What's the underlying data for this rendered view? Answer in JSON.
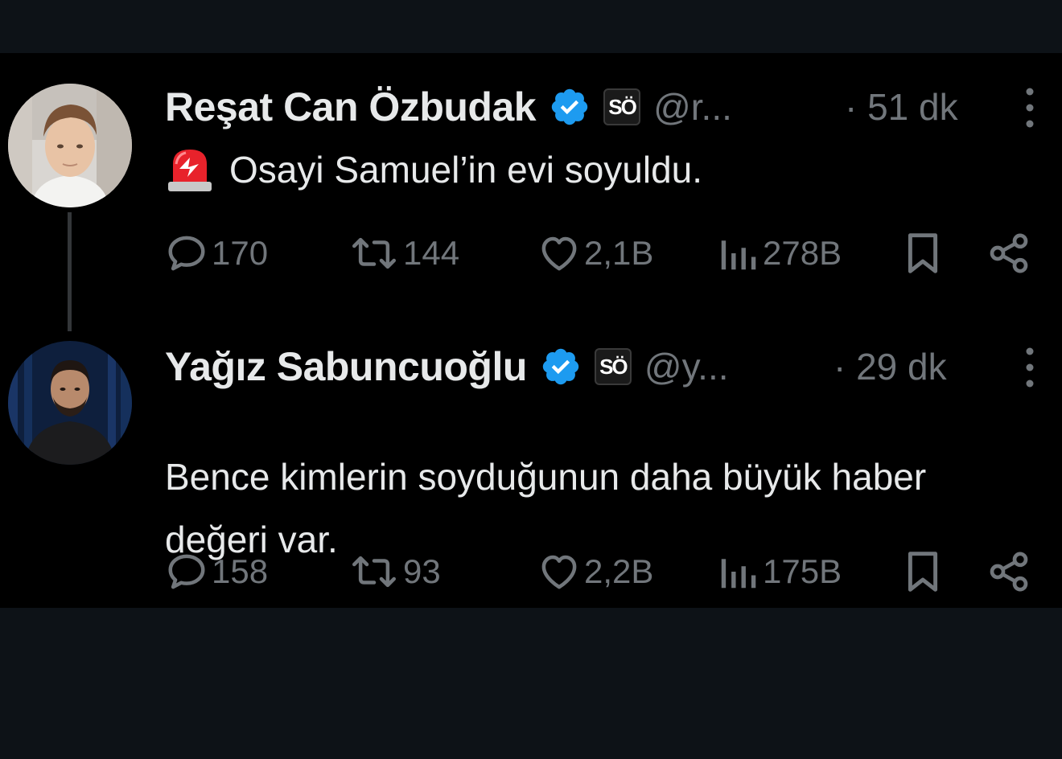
{
  "tweets": [
    {
      "display_name": "Reşat Can Özbudak",
      "verified_icon": "verified-badge-icon",
      "affiliate_badge": "SÖ",
      "handle": "@r...",
      "time": "· 51 dk",
      "emoji_icon": "police-light-icon",
      "text": "Osayi Samuel’in evi soyuldu.",
      "stats": {
        "replies": "170",
        "retweets": "144",
        "likes": "2,1B",
        "views": "278B"
      }
    },
    {
      "display_name": "Yağız Sabuncuoğlu",
      "verified_icon": "verified-badge-icon",
      "affiliate_badge": "SÖ",
      "handle": "@y...",
      "time": "· 29 dk",
      "text": "Bence kimlerin soyduğunun daha büyük haber değeri var.",
      "stats": {
        "replies": "158",
        "retweets": "93",
        "likes": "2,2B",
        "views": "175B"
      }
    }
  ],
  "colors": {
    "background": "#000000",
    "outer_background": "#0d1217",
    "primary_text": "#e7e9ea",
    "secondary_text": "#71767b",
    "verified_blue": "#1d9bf0"
  }
}
